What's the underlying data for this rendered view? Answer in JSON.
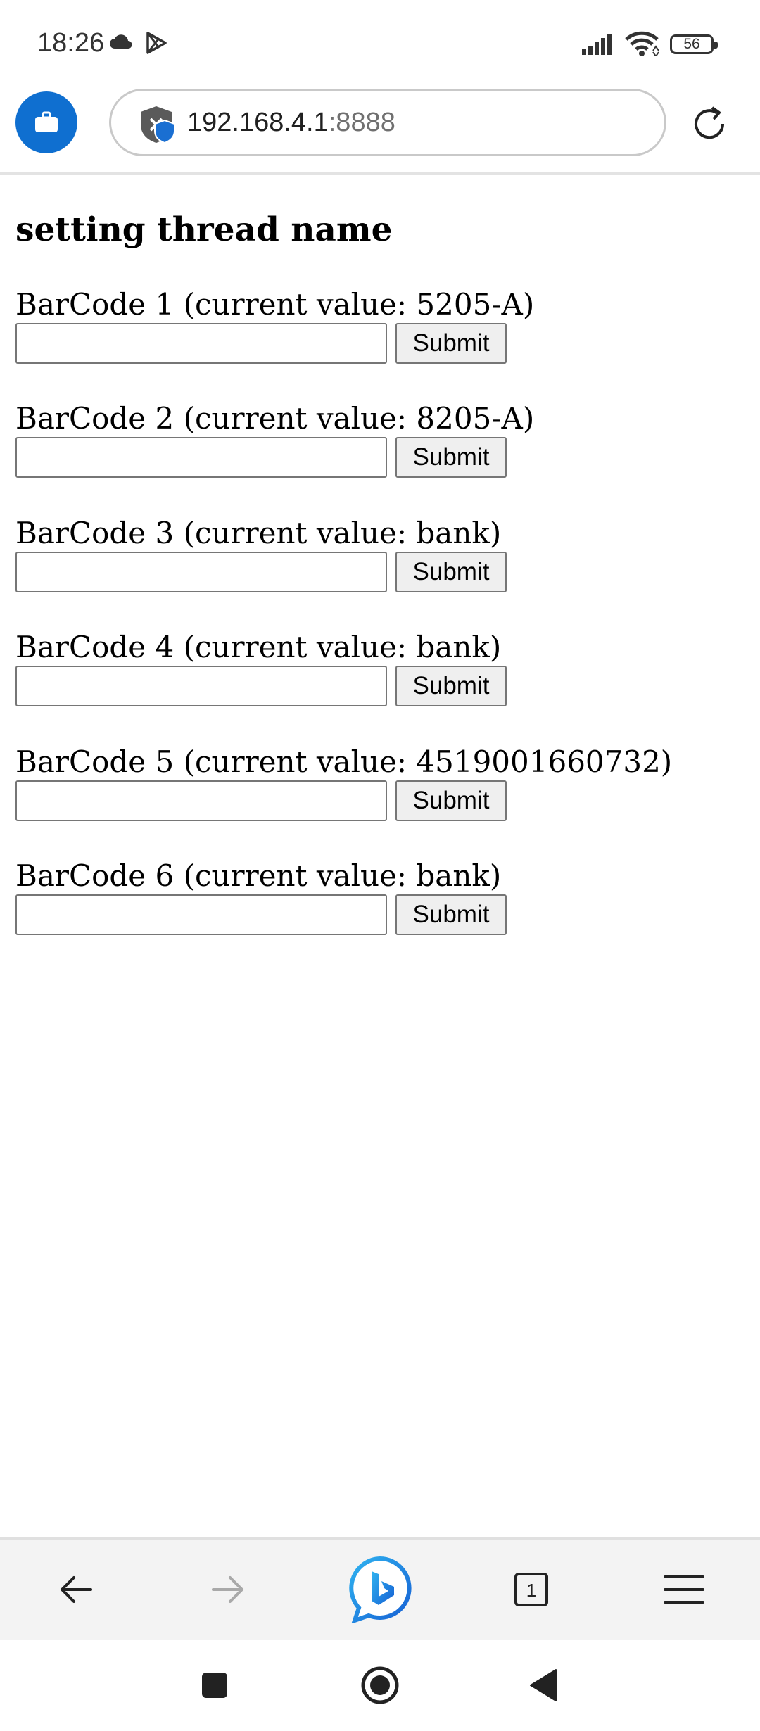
{
  "status_bar": {
    "time": "18:26",
    "battery": "56"
  },
  "browser": {
    "url_host": "192.168.4.1",
    "url_port": ":8888"
  },
  "page": {
    "title": "setting thread name",
    "fields": [
      {
        "label": "BarCode 1 (current value: 5205-A)",
        "value": "",
        "submit": "Submit"
      },
      {
        "label": "BarCode 2 (current value: 8205-A)",
        "value": "",
        "submit": "Submit"
      },
      {
        "label": "BarCode 3 (current value: bank)",
        "value": "",
        "submit": "Submit"
      },
      {
        "label": "BarCode 4 (current value: bank)",
        "value": "",
        "submit": "Submit"
      },
      {
        "label": "BarCode 5 (current value: 4519001660732)",
        "value": "",
        "submit": "Submit"
      },
      {
        "label": "BarCode 6 (current value: bank)",
        "value": "",
        "submit": "Submit"
      }
    ]
  },
  "bottom_bar": {
    "tab_count": "1"
  },
  "icons": {
    "status": [
      "cloud-icon",
      "play-store-icon",
      "signal-icon",
      "wifi-icon",
      "battery-icon"
    ],
    "toolbar": [
      "work-profile-icon",
      "shield-icon",
      "reload-icon"
    ],
    "bottom": [
      "back-arrow-icon",
      "forward-arrow-icon",
      "bing-icon",
      "tabs-icon",
      "menu-icon"
    ],
    "system": [
      "recents-icon",
      "home-icon",
      "back-icon"
    ]
  },
  "colors": {
    "accent": "#0f6fd0",
    "bing": "#1b8fe0"
  }
}
